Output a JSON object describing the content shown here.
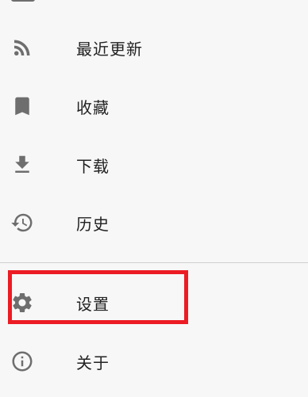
{
  "menu": {
    "items": [
      {
        "label": "最近更新",
        "icon": "rss-icon"
      },
      {
        "label": "收藏",
        "icon": "bookmark-icon"
      },
      {
        "label": "下载",
        "icon": "download-icon"
      },
      {
        "label": "历史",
        "icon": "history-icon"
      }
    ],
    "secondary": [
      {
        "label": "设置",
        "icon": "gear-icon"
      },
      {
        "label": "关于",
        "icon": "info-icon"
      }
    ]
  },
  "highlight_color": "#ec1c24",
  "icon_color": "#6e6e6e"
}
